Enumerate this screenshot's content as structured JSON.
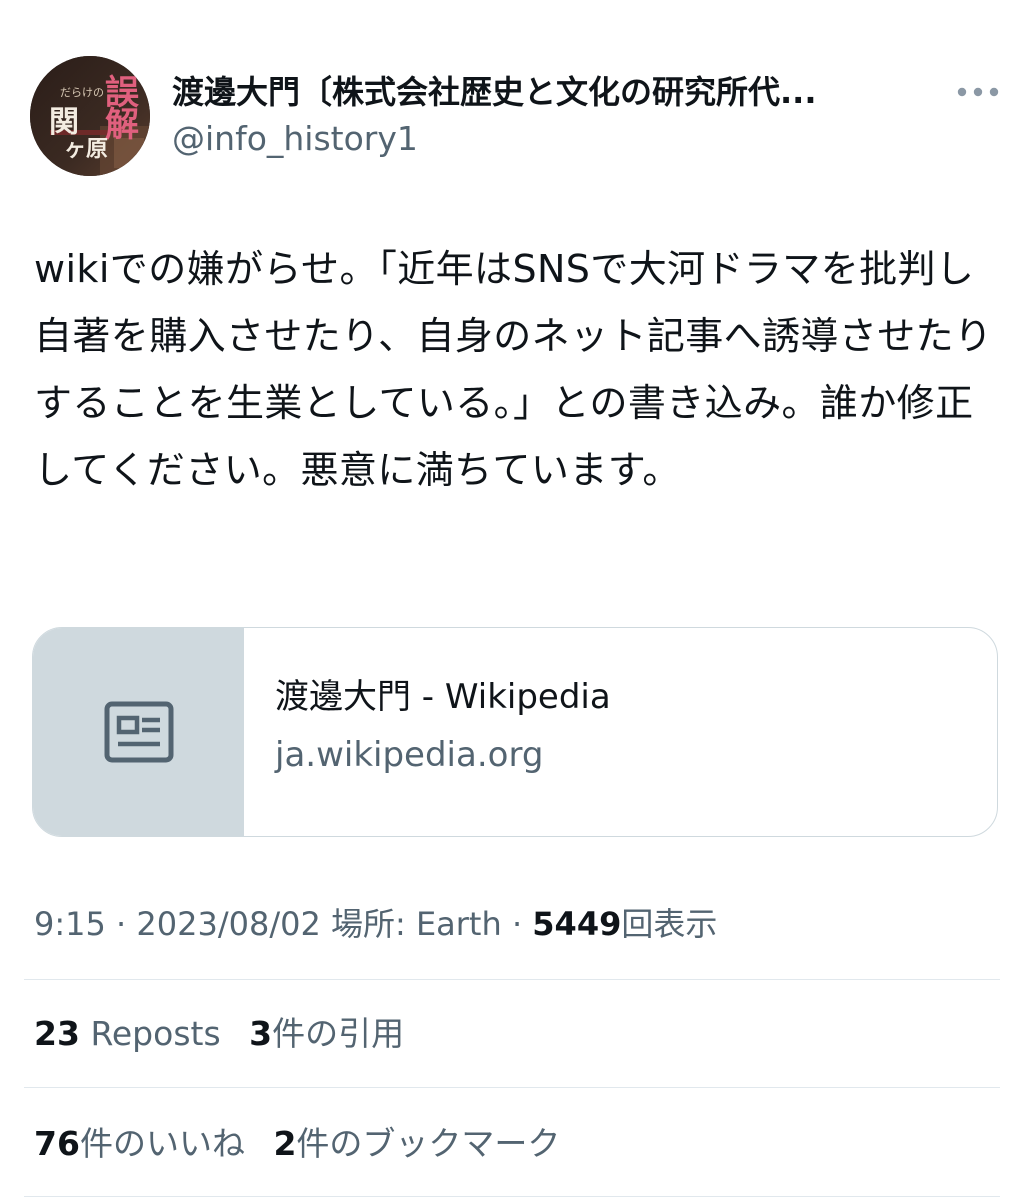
{
  "author": {
    "name": "渡邊大門〔株式会社歴史と文化の研究所代...",
    "handle": "@info_history1",
    "avatar_text": "誤解だらけの関ヶ原合戦"
  },
  "tweet": {
    "text": "wikiでの嫌がらせ。「近年はSNSで大河ドラマを批判し自著を購入させたり、自身のネット記事へ誘導させたりすることを生業としている。」との書き込み。誰か修正してください。悪意に満ちています。"
  },
  "link_card": {
    "title": "渡邊大門 - Wikipedia",
    "domain": "ja.wikipedia.org",
    "icon": "article-icon"
  },
  "meta": {
    "time": "9:15",
    "date": "2023/08/02",
    "location_label": "場所: Earth",
    "separator": "·",
    "views_count": "5449",
    "views_label": "回表示"
  },
  "stats": {
    "reposts_count": "23",
    "reposts_label": "Reposts",
    "quotes_count": "3",
    "quotes_label": "件の引用",
    "likes_count": "76",
    "likes_label": "件のいいね",
    "bookmarks_count": "2",
    "bookmarks_label": "件のブックマーク"
  },
  "colors": {
    "text_primary": "#0f1419",
    "text_secondary": "#536471",
    "border": "#cfd9de",
    "card_thumb_bg": "#cfd9de"
  }
}
